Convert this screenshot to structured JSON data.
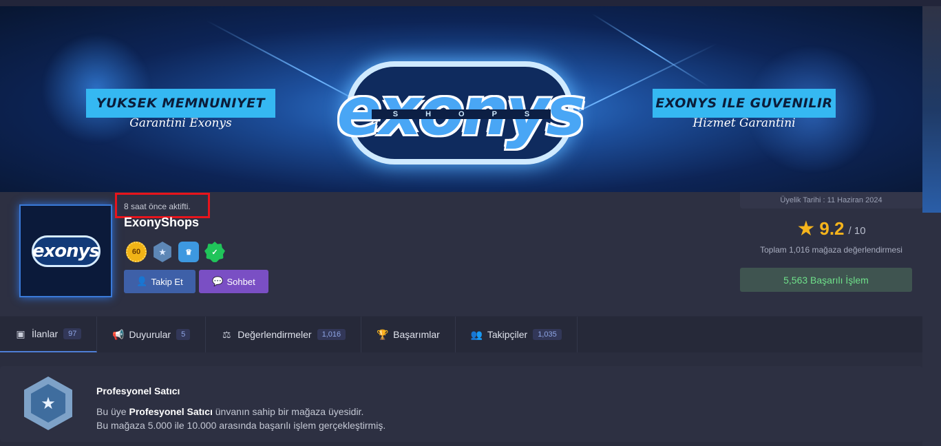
{
  "banner": {
    "left_title": "YUKSEK MEMNUNIYET",
    "left_sub": "Garantini Exonys",
    "right_title": "EXONYS ILE GUVENILIR",
    "right_sub": "Hizmet Garantini",
    "logo_text": "exonys",
    "logo_sub": "SHOPS"
  },
  "profile": {
    "active_status": "8 saat önce aktifti.",
    "shop_name": "ExonyShops",
    "badges": [
      {
        "icon": "level-60-badge",
        "text": "60"
      },
      {
        "icon": "star-hexagon-icon",
        "text": "★"
      },
      {
        "icon": "crown-icon",
        "text": "♛"
      },
      {
        "icon": "verified-check-icon",
        "text": "✓"
      }
    ],
    "follow_label": "Takip Et",
    "chat_label": "Sohbet"
  },
  "stats": {
    "member_since": "Üyelik Tarihi : 11 Haziran 2024",
    "rating": "9.2",
    "rating_out_of": "/ 10",
    "total_reviews": "Toplam 1,016 mağaza değerlendirmesi",
    "successful_trades": "5,563 Başarılı İşlem"
  },
  "tabs": [
    {
      "label": "İlanlar",
      "count": "97",
      "icon": "box-icon",
      "glyph": "▣"
    },
    {
      "label": "Duyurular",
      "count": "5",
      "icon": "megaphone-icon",
      "glyph": "📢"
    },
    {
      "label": "Değerlendirmeler",
      "count": "1,016",
      "icon": "scale-icon",
      "glyph": "⚖"
    },
    {
      "label": "Başarımlar",
      "count": "",
      "icon": "trophy-icon",
      "glyph": "🏆"
    },
    {
      "label": "Takipçiler",
      "count": "1,035",
      "icon": "users-icon",
      "glyph": "👥"
    }
  ],
  "pro_seller": {
    "title": "Profesyonel Satıcı",
    "line1_pre": "Bu üye ",
    "line1_bold": "Profesyonel Satıcı",
    "line1_post": " ünvanın sahip bir mağaza üyesidir.",
    "line2": "Bu mağaza 5.000 ile 10.000 arasında başarılı işlem gerçekleştirmiş."
  },
  "colors": {
    "accent": "#4e7fd6",
    "rating": "#f5b41c",
    "success": "#6fe08a",
    "highlight_box": "#e8141c"
  }
}
